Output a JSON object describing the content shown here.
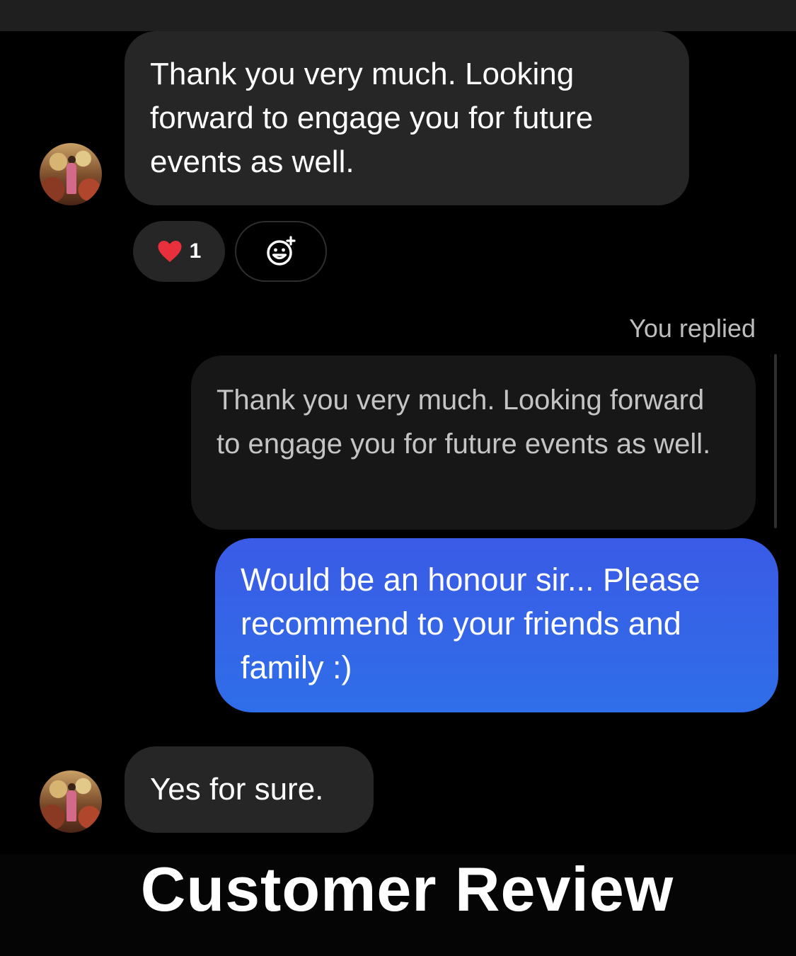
{
  "conversation": {
    "messages": [
      {
        "sender": "contact",
        "text": "Thank you very much. Looking forward to engage you for future events as well.",
        "reactions": [
          {
            "emoji": "❤️",
            "count": "1"
          }
        ]
      },
      {
        "sender": "you",
        "reply_label": "You replied",
        "quoted_text": "Thank you very much. Looking forward to engage you for future events as well.",
        "text": "Would be an honour sir... Please recommend to your friends and family :)"
      },
      {
        "sender": "contact",
        "text": "Yes for sure."
      }
    ]
  },
  "caption": "Customer Review",
  "colors": {
    "background": "#000000",
    "incoming_bubble": "#262626",
    "outgoing_bubble": "#3366e8",
    "quote_bubble": "#171717",
    "heart": "#e8303c"
  },
  "icons": [
    "heart-icon",
    "add-reaction-icon",
    "avatar"
  ]
}
